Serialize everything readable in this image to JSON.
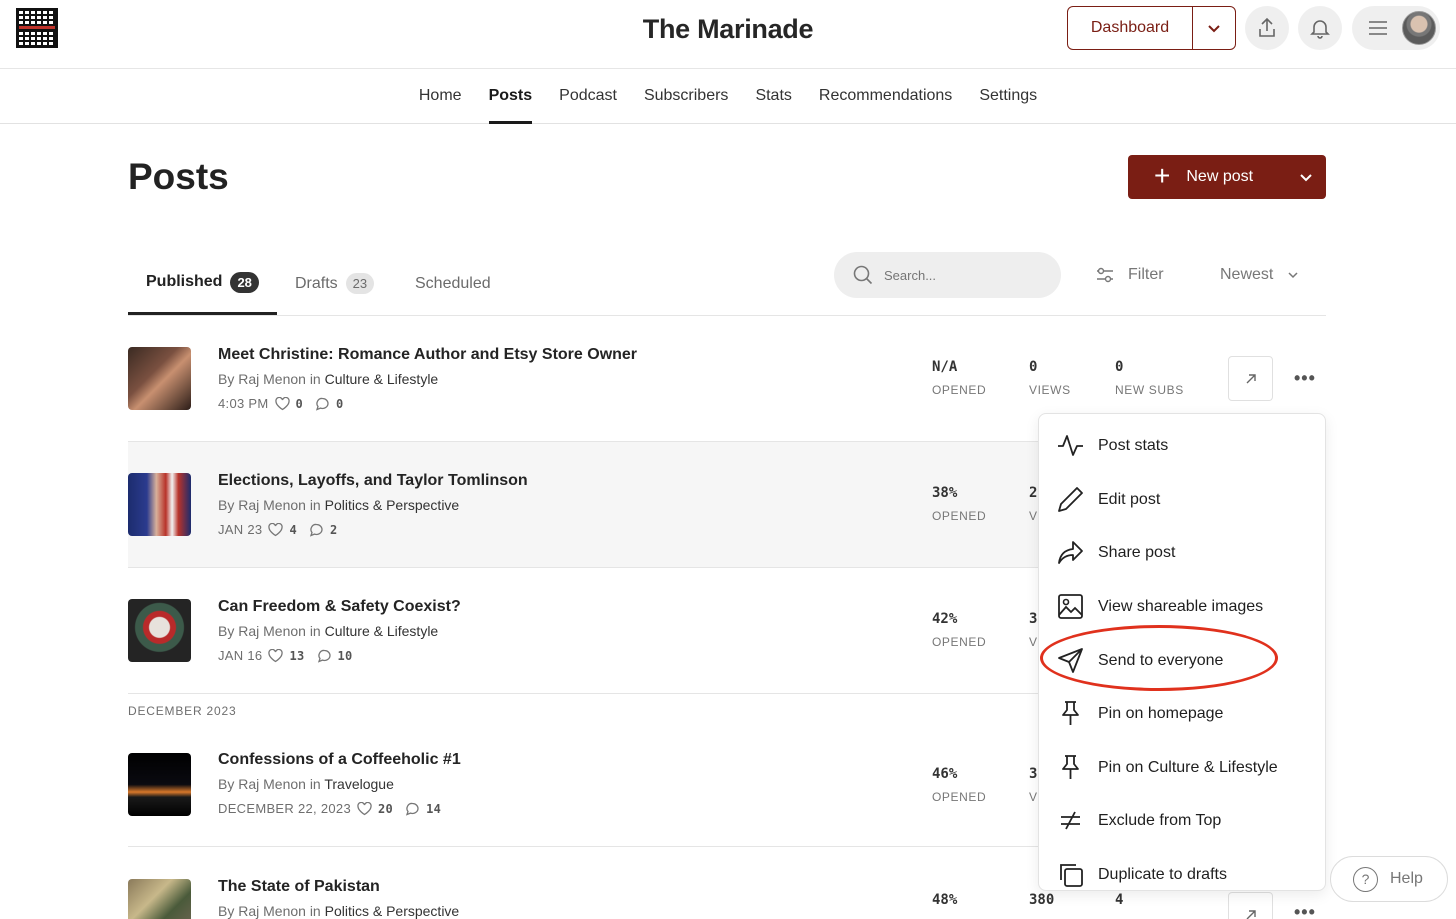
{
  "site": {
    "title": "The Marinade"
  },
  "header": {
    "dashboard_label": "Dashboard"
  },
  "nav": [
    "Home",
    "Posts",
    "Podcast",
    "Subscribers",
    "Stats",
    "Recommendations",
    "Settings"
  ],
  "page": {
    "title": "Posts",
    "new_post_label": "New post"
  },
  "tabs": {
    "published": {
      "label": "Published",
      "count": "28"
    },
    "drafts": {
      "label": "Drafts",
      "count": "23"
    },
    "scheduled": {
      "label": "Scheduled"
    }
  },
  "search": {
    "placeholder": "Search..."
  },
  "filter_label": "Filter",
  "sort_label": "Newest",
  "section_label": "DECEMBER 2023",
  "posts": [
    {
      "title": "Meet Christine: Romance Author and Etsy Store Owner",
      "by": "By Raj Menon in",
      "category": "Culture & Lifestyle",
      "date": "4:03 PM",
      "likes": "0",
      "comments": "0",
      "opened": "N/A",
      "opened_label": "OPENED",
      "views": "0",
      "views_label": "VIEWS",
      "subs": "0",
      "subs_label": "NEW SUBS"
    },
    {
      "title": "Elections, Layoffs, and Taylor Tomlinson",
      "by": "By Raj Menon in",
      "category": "Politics & Perspective",
      "date": "JAN 23",
      "likes": "4",
      "comments": "2",
      "opened": "38%",
      "opened_label": "OPENED",
      "views": "2",
      "views_label": "V"
    },
    {
      "title": "Can Freedom & Safety Coexist?",
      "by": "By Raj Menon in",
      "category": "Culture & Lifestyle",
      "date": "JAN 16",
      "likes": "13",
      "comments": "10",
      "opened": "42%",
      "opened_label": "OPENED",
      "views": "3",
      "views_label": "V"
    },
    {
      "title": "Confessions of a Coffeeholic #1",
      "by": "By Raj Menon in",
      "category": "Travelogue",
      "date": "DECEMBER 22, 2023",
      "likes": "20",
      "comments": "14",
      "opened": "46%",
      "opened_label": "OPENED",
      "views": "3",
      "views_label": "V"
    },
    {
      "title": "The State of Pakistan",
      "by": "By Raj Menon in",
      "category": "Politics & Perspective",
      "opened": "48%",
      "views": "380",
      "subs": "4"
    }
  ],
  "menu": [
    "Post stats",
    "Edit post",
    "Share post",
    "View shareable images",
    "Send to everyone",
    "Pin on homepage",
    "Pin on Culture & Lifestyle",
    "Exclude from Top",
    "Duplicate to drafts"
  ],
  "help_label": "Help",
  "colors": {
    "brand": "#7a1e14",
    "highlight": "#e0311d"
  }
}
